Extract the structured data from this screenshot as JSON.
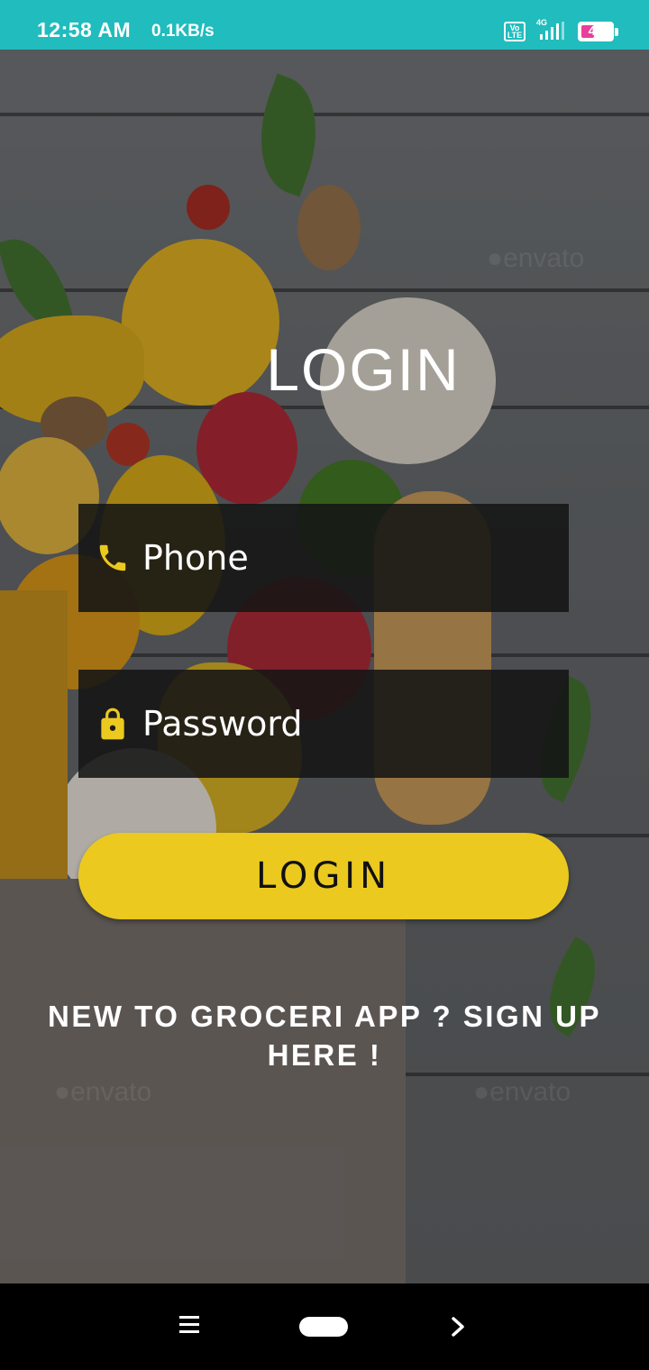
{
  "status_bar": {
    "time": "12:58 AM",
    "speed": "0.1KB/s",
    "volte": "Vo LTE",
    "network": "4G",
    "battery": "44",
    "battery_level": 0.44
  },
  "login": {
    "title": "LOGIN",
    "phone_placeholder": "Phone",
    "password_placeholder": "Password",
    "button_label": "LOGIN",
    "signup_text": "NEW TO GROCERI APP ? SIGN UP HERE !"
  },
  "colors": {
    "status_bar": "#21bcbd",
    "accent": "#ebc91f",
    "field_bg": "#141414"
  },
  "icons": {
    "phone": "phone-icon",
    "password": "lock-icon",
    "nav_menu": "menu-icon",
    "nav_home": "home-pill-icon",
    "nav_back": "chevron-right-icon"
  }
}
